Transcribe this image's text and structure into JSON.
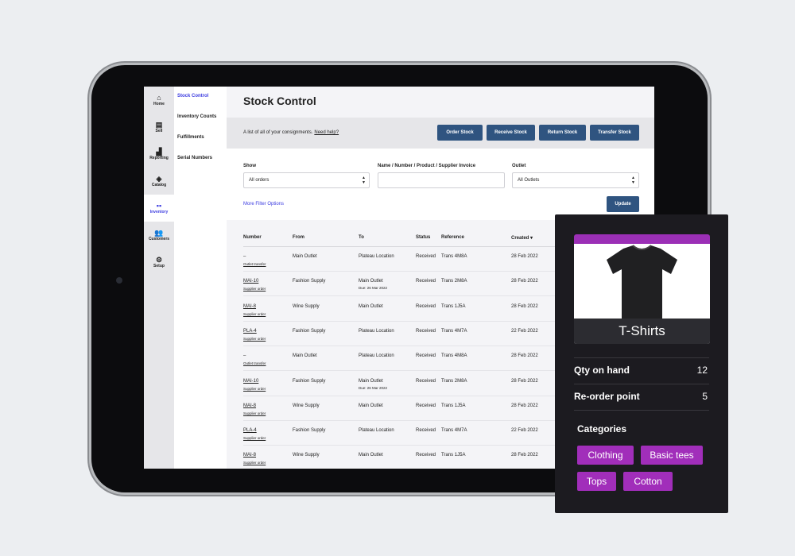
{
  "rail": [
    {
      "label": "Home",
      "icon": "home-icon",
      "glyph": "⌂"
    },
    {
      "label": "Sell",
      "icon": "register-icon",
      "glyph": "▤"
    },
    {
      "label": "Reporting",
      "icon": "chart-icon",
      "glyph": "▟"
    },
    {
      "label": "Catalog",
      "icon": "tag-icon",
      "glyph": "◈"
    },
    {
      "label": "Inventory",
      "icon": "boxes-icon",
      "glyph": "▪▪"
    },
    {
      "label": "Customers",
      "icon": "users-icon",
      "glyph": "👥"
    },
    {
      "label": "Setup",
      "icon": "gear-icon",
      "glyph": "⚙"
    }
  ],
  "subnav": [
    "Stock Control",
    "Inventory Counts",
    "Fulfillments",
    "Serial Numbers"
  ],
  "page": {
    "title": "Stock Control",
    "description": "A list of all of your consignments.",
    "help": "Need help?"
  },
  "buttons": [
    "Order Stock",
    "Receive Stock",
    "Return Stock",
    "Transfer Stock"
  ],
  "filters": {
    "show_label": "Show",
    "show_value": "All orders",
    "search_label": "Name / Number / Product / Supplier Invoice",
    "search_value": "",
    "outlet_label": "Outlet",
    "outlet_value": "All Outlets",
    "more": "More Filter Options",
    "update": "Update"
  },
  "table": {
    "headers": [
      "Number",
      "From",
      "To",
      "Status",
      "Reference",
      "Created ▾"
    ],
    "rows": [
      {
        "number": "–",
        "type": "Outlet transfer",
        "from": "Main Outlet",
        "to": "Plateau Location",
        "due": "",
        "status": "Received",
        "ref": "Trans 4M8A",
        "created": "28 Feb 2022"
      },
      {
        "number": "MAI-10",
        "type": "Supplier order",
        "from": "Fashion Supply",
        "to": "Main Outlet",
        "due": "Due: 26 Mar 2022",
        "status": "Received",
        "ref": "Trans 2M8A",
        "created": "28 Feb 2022"
      },
      {
        "number": "MAI-8",
        "type": "Supplier order",
        "from": "Wine Supply",
        "to": "Main Outlet",
        "due": "",
        "status": "Received",
        "ref": "Trans 1J5A",
        "created": "28 Feb 2022"
      },
      {
        "number": "PLA-4",
        "type": "Supplier order",
        "from": "Fashion Supply",
        "to": "Plateau Location",
        "due": "",
        "status": "Received",
        "ref": "Trans 4M7A",
        "created": "22 Feb 2022"
      },
      {
        "number": "–",
        "type": "Outlet transfer",
        "from": "Main Outlet",
        "to": "Plateau Location",
        "due": "",
        "status": "Received",
        "ref": "Trans 4M8A",
        "created": "28 Feb 2022"
      },
      {
        "number": "MAI-10",
        "type": "Supplier order",
        "from": "Fashion Supply",
        "to": "Main Outlet",
        "due": "Due: 26 Mar 2022",
        "status": "Received",
        "ref": "Trans 2M8A",
        "created": "28 Feb 2022"
      },
      {
        "number": "MAI-8",
        "type": "Supplier order",
        "from": "Wine Supply",
        "to": "Main Outlet",
        "due": "",
        "status": "Received",
        "ref": "Trans 1J5A",
        "created": "28 Feb 2022"
      },
      {
        "number": "PLA-4",
        "type": "Supplier order",
        "from": "Fashion Supply",
        "to": "Plateau Location",
        "due": "",
        "status": "Received",
        "ref": "Trans 4M7A",
        "created": "22 Feb 2022"
      },
      {
        "number": "MAI-8",
        "type": "Supplier order",
        "from": "Wine Supply",
        "to": "Main Outlet",
        "due": "",
        "status": "Received",
        "ref": "Trans 1J5A",
        "created": "28 Feb 2022"
      }
    ]
  },
  "product_card": {
    "name": "T-Shirts",
    "qty_label": "Qty on hand",
    "qty": "12",
    "reorder_label": "Re-order point",
    "reorder": "5",
    "categories_label": "Categories",
    "tags": [
      "Clothing",
      "Basic tees",
      "Tops",
      "Cotton"
    ],
    "accent": "#a12eba"
  }
}
